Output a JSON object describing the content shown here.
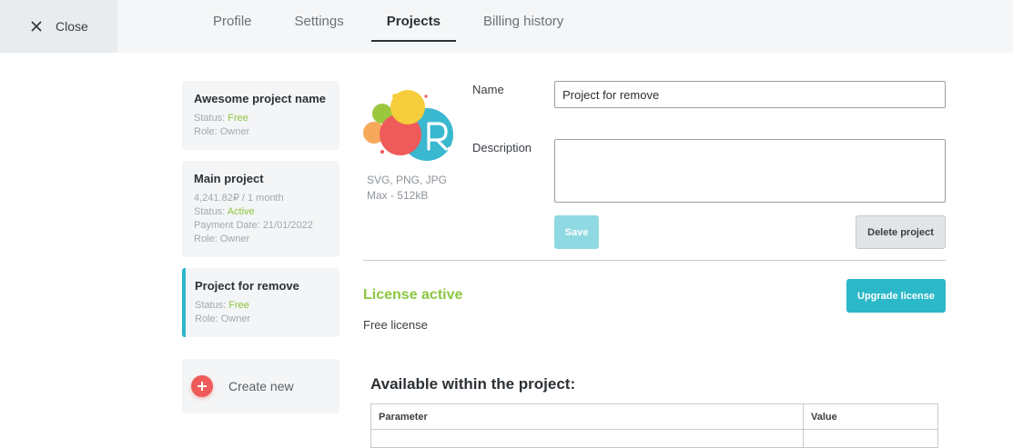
{
  "header": {
    "close_label": "Close",
    "tabs": [
      {
        "label": "Profile",
        "active": false
      },
      {
        "label": "Settings",
        "active": false
      },
      {
        "label": "Projects",
        "active": true
      },
      {
        "label": "Billing history",
        "active": false
      }
    ]
  },
  "projects": [
    {
      "name": "Awesome project name",
      "status_prefix": "Status: ",
      "status": "Free",
      "role": "Role: Owner"
    },
    {
      "name": "Main project",
      "price": "4,241.82₽ / 1 month",
      "status_prefix": "Status: ",
      "status": "Active",
      "payment_date": "Payment Date: 21/01/2022",
      "role": "Role: Owner"
    },
    {
      "name": "Project for remove",
      "status_prefix": "Status: ",
      "status": "Free",
      "role": "Role: Owner",
      "active": true
    }
  ],
  "create_new_label": "Create new",
  "logo": {
    "hint_formats": "SVG, PNG, JPG",
    "hint_size": "Max - 512kB"
  },
  "form": {
    "name_label": "Name",
    "name_value": "Project for remove",
    "description_label": "Description",
    "description_value": "",
    "save_label": "Save",
    "delete_label": "Delete project"
  },
  "license": {
    "title": "License active",
    "subtitle": "Free license",
    "upgrade_label": "Upgrade license"
  },
  "available": {
    "title": "Available within the project:",
    "columns": [
      "Parameter",
      "Value"
    ]
  },
  "colors": {
    "accent": "#2bb8c8",
    "status_green": "#8cc63f",
    "create_red": "#ef5a5a"
  }
}
